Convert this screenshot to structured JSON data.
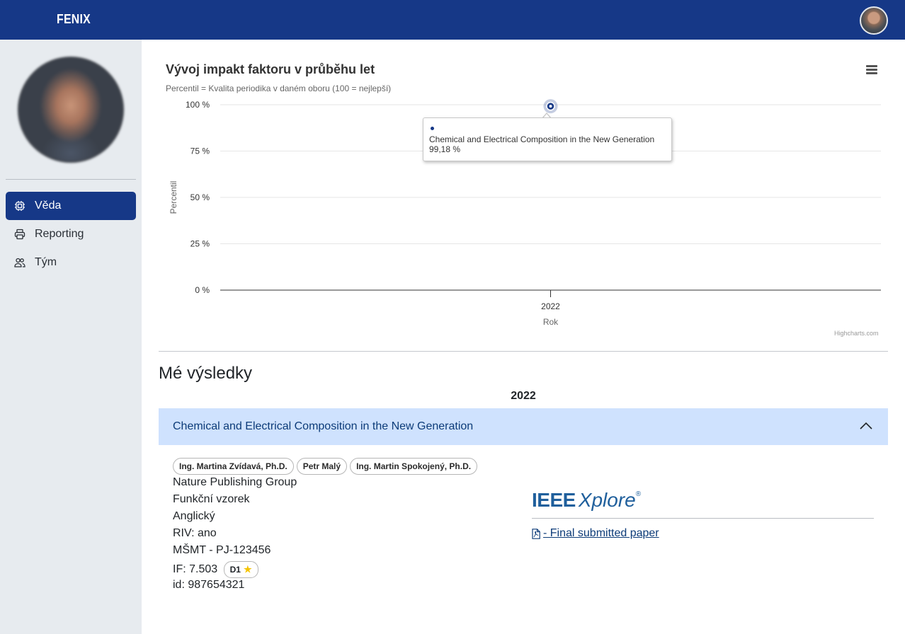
{
  "app": {
    "brand": "FENIX"
  },
  "sidebar": {
    "items": [
      {
        "label": "Věda",
        "icon": "chip-icon",
        "active": true
      },
      {
        "label": "Reporting",
        "icon": "printer-icon",
        "active": false
      },
      {
        "label": "Tým",
        "icon": "people-icon",
        "active": false
      }
    ]
  },
  "chart": {
    "title": "Vývoj impakt faktoru v průběhu let",
    "subtitle": "Percentil = Kvalita periodika v daném oboru (100 = nejlepší)",
    "credit": "Highcharts.com",
    "tooltip": {
      "series": "Chemical and Electrical Composition in the New Generation",
      "value": "99,18 %"
    }
  },
  "chart_data": {
    "type": "scatter",
    "xlabel": "Rok",
    "ylabel": "Percentil",
    "categories": [
      "2022"
    ],
    "yticks": [
      "0 %",
      "25 %",
      "50 %",
      "75 %",
      "100 %"
    ],
    "ylim": [
      0,
      100
    ],
    "grid": true,
    "series": [
      {
        "name": "Chemical and Electrical Composition in the New Generation",
        "x": [
          "2022"
        ],
        "values": [
          99.18
        ]
      }
    ]
  },
  "results": {
    "title": "Mé výsledky",
    "year": "2022",
    "publication": {
      "title": "Chemical and Electrical Composition in the New Generation",
      "authors": [
        "Ing. Martina Zvídavá, Ph.D.",
        "Petr Malý",
        "Ing. Martin Spokojený, Ph.D."
      ],
      "publisher": "Nature Publishing Group",
      "type": "Funkční vzorek",
      "language": "Anglický",
      "riv": "RIV: ano",
      "grant": "MŠMT - PJ-123456",
      "if_label": "IF: 7.503",
      "quartile": "D1",
      "id_label": "id: 987654321",
      "logo_ieee": "IEEE",
      "logo_xplore": "Xplore",
      "logo_reg": "®",
      "pdf_link": " - Final submitted paper"
    }
  },
  "colors": {
    "navbar": "#163887",
    "sidebar": "#e7ebef",
    "accordion": "#cfe2fe",
    "link": "#0c3b78"
  }
}
